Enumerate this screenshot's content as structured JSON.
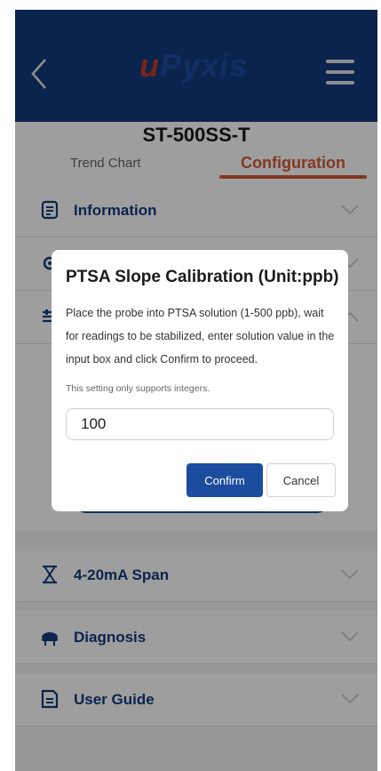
{
  "header": {
    "back_icon": "chevron-left-icon",
    "logo_u": "u",
    "logo_rest": "Pyxis",
    "menu_icon": "hamburger-menu-icon",
    "bg_color": "#123a7c"
  },
  "device": {
    "title": "ST-500SS-T",
    "tabs": [
      {
        "label": "Trend Chart",
        "active": false
      },
      {
        "label": "Configuration",
        "active": true
      }
    ],
    "accent": "#d55a38"
  },
  "accordion": [
    {
      "label": "Information",
      "icon": "document-icon"
    },
    {
      "label": "",
      "icon": "gear-icon"
    },
    {
      "label": "",
      "icon": "sliders-icon"
    },
    {
      "label": "4-20mA Span",
      "icon": "hourglass-icon"
    },
    {
      "label": "Diagnosis",
      "icon": "diagnosis-icon"
    },
    {
      "label": "User Guide",
      "icon": "guide-icon"
    }
  ],
  "dialog": {
    "title": "PTSA Slope Calibration (Unit:ppb)",
    "description": "Place the probe into PTSA solution (1-500 ppb), wait for readings to be stabilized, enter solution value in the input box and click Confirm to proceed.",
    "note": "This setting only supports integers.",
    "input_value": "100",
    "confirm_label": "Confirm",
    "cancel_label": "Cancel"
  }
}
